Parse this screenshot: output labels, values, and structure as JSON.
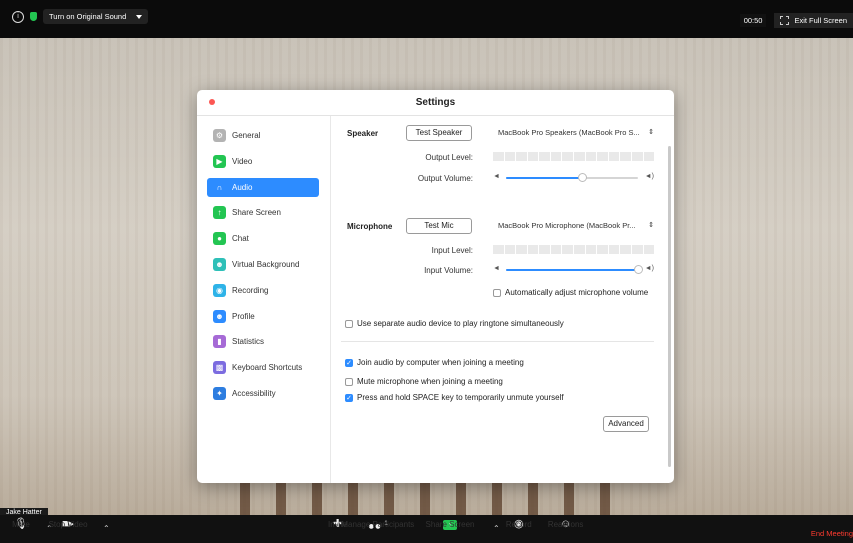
{
  "topbar": {
    "sound_button": "Turn on Original Sound",
    "timer": "00:50",
    "exit_fullscreen": "Exit Full Screen"
  },
  "video": {
    "participant_name": "Jake Hatter"
  },
  "toolbar": {
    "mute": "Mute",
    "stop_video": "Stop Video",
    "invite": "Invite",
    "manage_participants": "Manage Participants",
    "participant_count": "1",
    "share_screen": "Share Screen",
    "record": "Record",
    "reactions": "Reactions",
    "end_meeting": "End Meeting"
  },
  "settings": {
    "title": "Settings",
    "sidebar": [
      {
        "label": "General",
        "icon": "gear-icon",
        "color": "#b3b3b3"
      },
      {
        "label": "Video",
        "icon": "video-camera-icon",
        "color": "#23c552"
      },
      {
        "label": "Audio",
        "icon": "headphones-icon",
        "color": "#2d8cff",
        "active": true
      },
      {
        "label": "Share Screen",
        "icon": "share-screen-icon",
        "color": "#23c552"
      },
      {
        "label": "Chat",
        "icon": "chat-bubble-icon",
        "color": "#23c552"
      },
      {
        "label": "Virtual Background",
        "icon": "person-background-icon",
        "color": "#2ec0b8"
      },
      {
        "label": "Recording",
        "icon": "record-circle-icon",
        "color": "#2eb3e8"
      },
      {
        "label": "Profile",
        "icon": "person-icon",
        "color": "#2d8cff"
      },
      {
        "label": "Statistics",
        "icon": "bar-chart-icon",
        "color": "#a66ad6"
      },
      {
        "label": "Keyboard Shortcuts",
        "icon": "keyboard-icon",
        "color": "#7c6ce0"
      },
      {
        "label": "Accessibility",
        "icon": "accessibility-icon",
        "color": "#2d7de0"
      }
    ],
    "audio": {
      "speaker_label": "Speaker",
      "test_speaker": "Test Speaker",
      "speaker_device": "MacBook Pro Speakers (MacBook Pro S...",
      "output_level_label": "Output Level:",
      "output_volume_label": "Output Volume:",
      "output_volume": 0.58,
      "microphone_label": "Microphone",
      "test_mic": "Test Mic",
      "mic_device": "MacBook Pro Microphone (MacBook Pr...",
      "input_level_label": "Input Level:",
      "input_volume_label": "Input Volume:",
      "input_volume": 1.0,
      "auto_adjust": {
        "label": "Automatically adjust microphone volume",
        "checked": false
      },
      "separate_device": {
        "label": "Use separate audio device to play ringtone simultaneously",
        "checked": false
      },
      "join_audio": {
        "label": "Join audio by computer when joining a meeting",
        "checked": true
      },
      "mute_mic": {
        "label": "Mute microphone when joining a meeting",
        "checked": false
      },
      "space_unmute": {
        "label": "Press and hold SPACE key to temporarily unmute yourself",
        "checked": true
      },
      "advanced": "Advanced"
    }
  }
}
